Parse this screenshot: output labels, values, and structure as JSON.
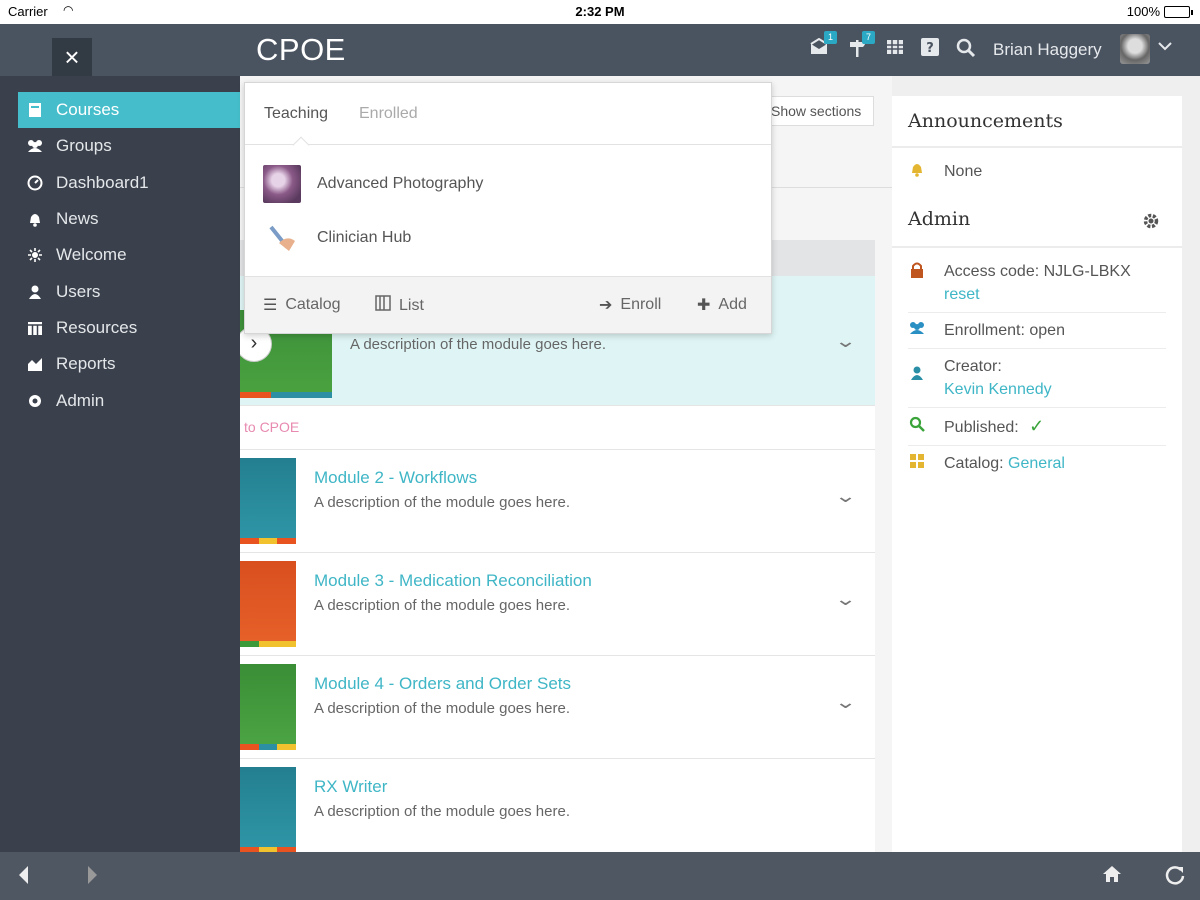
{
  "status_bar": {
    "carrier": "Carrier",
    "time": "2:32 PM",
    "battery": "100%"
  },
  "header": {
    "title": "CPOE",
    "close_label": "×",
    "user_name": "Brian Haggery",
    "badges": {
      "inbox": "1",
      "notifications": "7"
    }
  },
  "sidebar": {
    "items": [
      {
        "label": "Courses",
        "icon": "courses-icon",
        "active": true
      },
      {
        "label": "Groups",
        "icon": "groups-icon"
      },
      {
        "label": "Dashboard1",
        "icon": "dashboard-icon"
      },
      {
        "label": "News",
        "icon": "news-icon"
      },
      {
        "label": "Welcome",
        "icon": "welcome-icon"
      },
      {
        "label": "Users",
        "icon": "users-icon"
      },
      {
        "label": "Resources",
        "icon": "resources-icon"
      },
      {
        "label": "Reports",
        "icon": "reports-icon"
      },
      {
        "label": "Admin",
        "icon": "admin-icon"
      }
    ]
  },
  "dropdown": {
    "tabs": [
      "Teaching",
      "Enrolled"
    ],
    "courses": [
      "Advanced Photography",
      "Clinician Hub"
    ],
    "actions": {
      "catalog": "Catalog",
      "list": "List",
      "enroll": "Enroll",
      "add": "Add"
    }
  },
  "main": {
    "show_sections": "Show sections",
    "intro_link": "to CPOE",
    "modules": [
      {
        "title": "",
        "description": "A description of the module goes here."
      },
      {
        "title": "Module 2 - Workflows",
        "description": "A description of the module goes here."
      },
      {
        "title": "Module 3 - Medication Reconciliation",
        "description": "A description of the module goes here."
      },
      {
        "title": "Module 4 - Orders and Order Sets",
        "description": "A description of the module goes here."
      },
      {
        "title": "RX Writer",
        "description": "A description of the module goes here."
      }
    ]
  },
  "announcements": {
    "heading": "Announcements",
    "value": "None"
  },
  "admin": {
    "heading": "Admin",
    "access_code_label": "Access code: NJLG-LBKX",
    "reset": "reset",
    "enrollment": "Enrollment: open",
    "creator_label": "Creator:",
    "creator_name": "Kevin Kennedy",
    "published_label": "Published:",
    "published_mark": "✓",
    "catalog_label": "Catalog:",
    "catalog_value": "General"
  },
  "colors": {
    "accent": "#45bdca",
    "sidebar": "#3a414c",
    "header": "#4a5360",
    "link": "#3fb6c6"
  }
}
